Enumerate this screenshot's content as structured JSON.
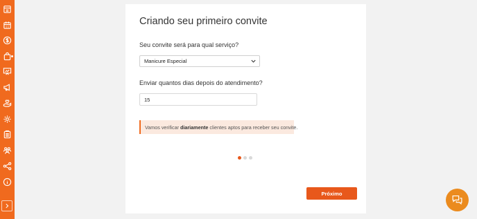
{
  "sidebar": {
    "items": [
      {
        "icon": "store-icon"
      },
      {
        "icon": "calendar-icon"
      },
      {
        "icon": "dollar-icon"
      },
      {
        "icon": "shopping-bag-icon"
      },
      {
        "icon": "presentation-chart-icon"
      },
      {
        "icon": "megaphone-icon"
      },
      {
        "icon": "hand-heart-icon"
      },
      {
        "icon": "gear-icon"
      },
      {
        "icon": "clipboard-icon"
      },
      {
        "icon": "users-icon"
      },
      {
        "icon": "share-icon"
      },
      {
        "icon": "info-icon"
      }
    ],
    "expand_icon": "chevron-right-icon"
  },
  "wizard": {
    "title": "Criando seu primeiro convite",
    "service_question": "Seu convite será para qual serviço?",
    "service_selected": "Manicure Especial",
    "days_question": "Enviar quantos dias depois do atendimento?",
    "days_value": "15",
    "alert": {
      "prefix": "Vamos verificar",
      "bold": "diariamente",
      "suffix": "clientes aptos para receber seu convite."
    },
    "steps": {
      "total": 3,
      "current": 1
    },
    "next_label": "Próximo"
  },
  "chat": {
    "icon": "chat-bubbles-icon"
  },
  "colors": {
    "accent": "#f06a1e",
    "button": "#e8581b",
    "alert_bg": "#fbe9df",
    "chat": "#eb8b1e"
  }
}
